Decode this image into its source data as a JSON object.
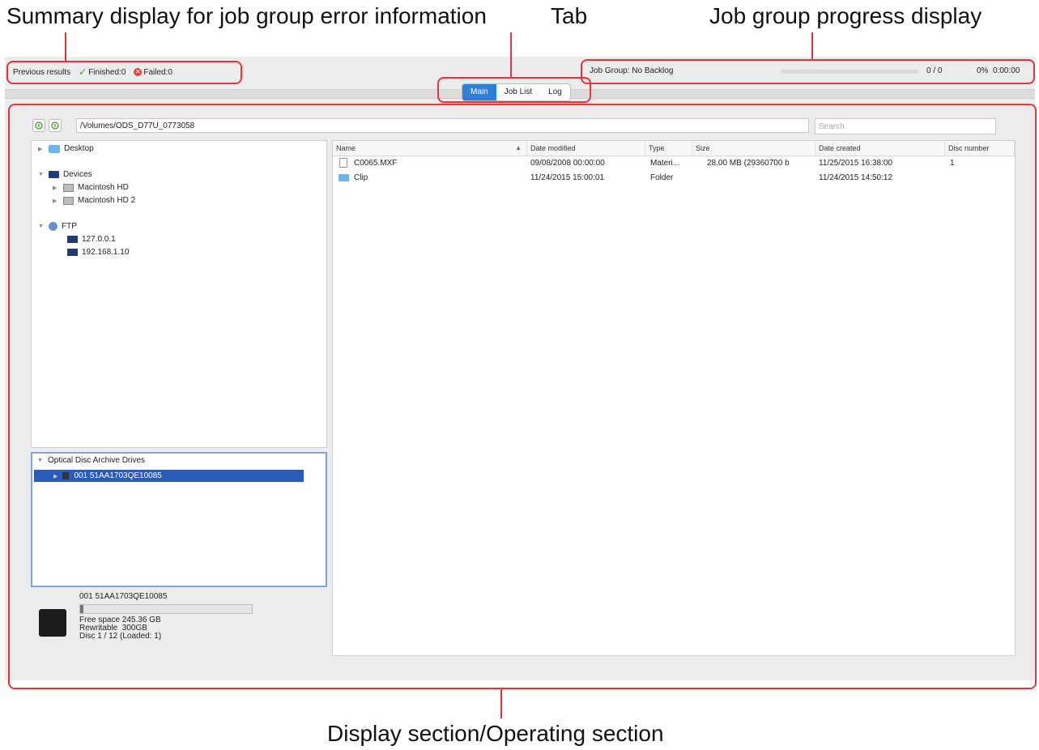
{
  "annotations": {
    "summary_label": "Summary display for job group error information",
    "tab_label": "Tab",
    "progress_label": "Job group progress display",
    "display_label": "Display section/Operating section"
  },
  "summary": {
    "previous_results": "Previous results",
    "finished": "Finished:0",
    "failed": "Failed:0"
  },
  "tabs": [
    "Main",
    "Job List",
    "Log"
  ],
  "job_group": {
    "label": "Job Group: No Backlog",
    "count": "0 / 0",
    "percent_time": "0%  0:00:00",
    "progress": 0
  },
  "path": "/Volumes/ODS_D77U_0773058",
  "search_placeholder": "Search",
  "tree": {
    "desktop": "Desktop",
    "devices": "Devices",
    "macintosh_hd": "Macintosh HD",
    "macintosh_hd2": "Macintosh HD 2",
    "ftp": "FTP",
    "ftp_host1": "127.0.0.1",
    "ftp_host2": "192.168.1.10"
  },
  "odad": {
    "title": "Optical Disc Archive Drives",
    "drive": "001 51AA1703QE10085"
  },
  "drive_info": {
    "name": "001 51AA1703QE10085",
    "free_space": "Free space 245.36 GB",
    "rewritable": "Rewritable  300GB",
    "disc": "Disc 1 / 12 (Loaded: 1)",
    "usage_fraction": 0.02
  },
  "columns": [
    "Name",
    "Date modified",
    "Type",
    "Size",
    "Date created",
    "Disc number"
  ],
  "sort_indicator": "▲",
  "files": [
    {
      "name": "C0065.MXF",
      "modified": "09/08/2008 00:00:00",
      "type": "Materi...",
      "size": "28.00 MB (29360700 b",
      "created": "11/25/2015 16:38:00",
      "disc": "1",
      "icon": "file-icon"
    },
    {
      "name": "Clip",
      "modified": "11/24/2015 15:00:01",
      "type": "Folder",
      "size": "",
      "created": "11/24/2015 14:50:12",
      "disc": "",
      "icon": "folder-icon"
    }
  ],
  "colors": {
    "accent": "#2f7fd8",
    "annotation": "#e8333a",
    "selection": "#2a5bb8"
  }
}
